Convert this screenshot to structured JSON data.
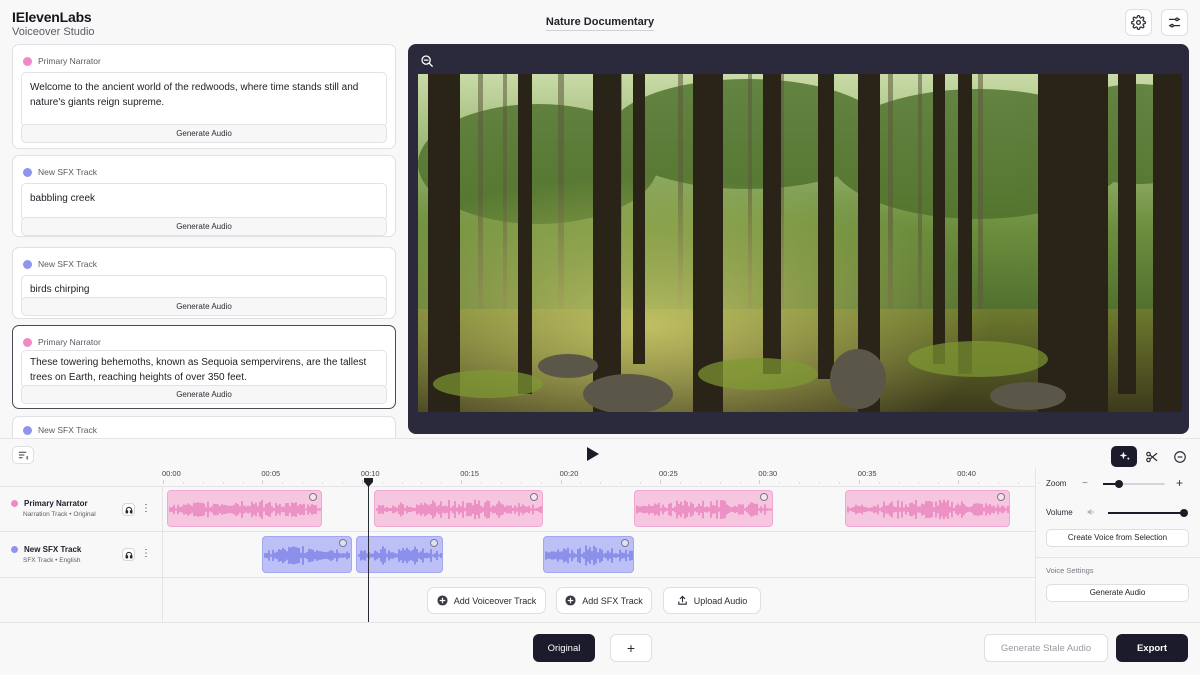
{
  "app": {
    "name": "IElevenLabs",
    "subtitle": "Voiceover Studio",
    "project_title": "Nature Documentary"
  },
  "colors": {
    "narrator": "#f08ac6",
    "sfx": "#8f95ec",
    "preview_bg": "#2b2a3c",
    "primary_dark": "#1c1b2c"
  },
  "cards": [
    {
      "track": "Primary Narrator",
      "color": "#f08ac6",
      "text": "Welcome to the ancient world of the redwoods, where time stands still and nature's giants reign supreme.",
      "button": "Generate Audio",
      "selected": false
    },
    {
      "track": "New SFX Track",
      "color": "#8f95ec",
      "text": "babbling creek",
      "button": "Generate Audio",
      "selected": false
    },
    {
      "track": "New SFX Track",
      "color": "#8f95ec",
      "text": "birds chirping",
      "button": "Generate Audio",
      "selected": false
    },
    {
      "track": "Primary Narrator",
      "color": "#f08ac6",
      "text": "These towering behemoths, known as Sequoia sempervirens, are the tallest trees on Earth, reaching heights of over 350 feet.",
      "button": "Generate Audio",
      "selected": true
    },
    {
      "track": "New SFX Track",
      "color": "#8f95ec"
    }
  ],
  "timeline": {
    "ticks": [
      "00:00",
      "00:05",
      "00:10",
      "00:15",
      "00:20",
      "00:25",
      "00:30",
      "00:35",
      "00:40"
    ],
    "playhead_seconds": 10.1,
    "tracks": [
      {
        "name": "Primary Narrator",
        "sub": "Narration Track • Original",
        "color": "#f08ac6"
      },
      {
        "name": "New SFX Track",
        "sub": "SFX Track • English",
        "color": "#8f95ec"
      }
    ],
    "narrator_clips": [
      {
        "start": 0,
        "end": 7.8
      },
      {
        "start": 10.4,
        "end": 18.9
      },
      {
        "start": 23.5,
        "end": 30.5
      },
      {
        "start": 34.1,
        "end": 42.4
      }
    ],
    "sfx_clips": [
      {
        "start": 4.8,
        "end": 9.3
      },
      {
        "start": 9.5,
        "end": 13.9
      },
      {
        "start": 18.9,
        "end": 23.5
      }
    ],
    "add_voiceover": "Add Voiceover Track",
    "add_sfx": "Add SFX Track",
    "upload": "Upload Audio"
  },
  "side_panel": {
    "zoom_label": "Zoom",
    "zoom_level": 0.26,
    "volume_label": "Volume",
    "volume_level": 1.0,
    "create_voice": "Create Voice from Selection",
    "voice_settings": "Voice Settings",
    "generate": "Generate Audio"
  },
  "bottom": {
    "original": "Original",
    "add": "+",
    "generate_stale": "Generate Stale Audio",
    "export": "Export"
  },
  "icons": {
    "settings": "gear-icon",
    "mix": "sliders-icon",
    "zoom_out": "zoom-out-icon",
    "timeline_toggle": "list-icon",
    "play": "play-icon",
    "magic": "sparkle-icon",
    "cut": "scissors-icon",
    "remove": "minus-icon"
  }
}
